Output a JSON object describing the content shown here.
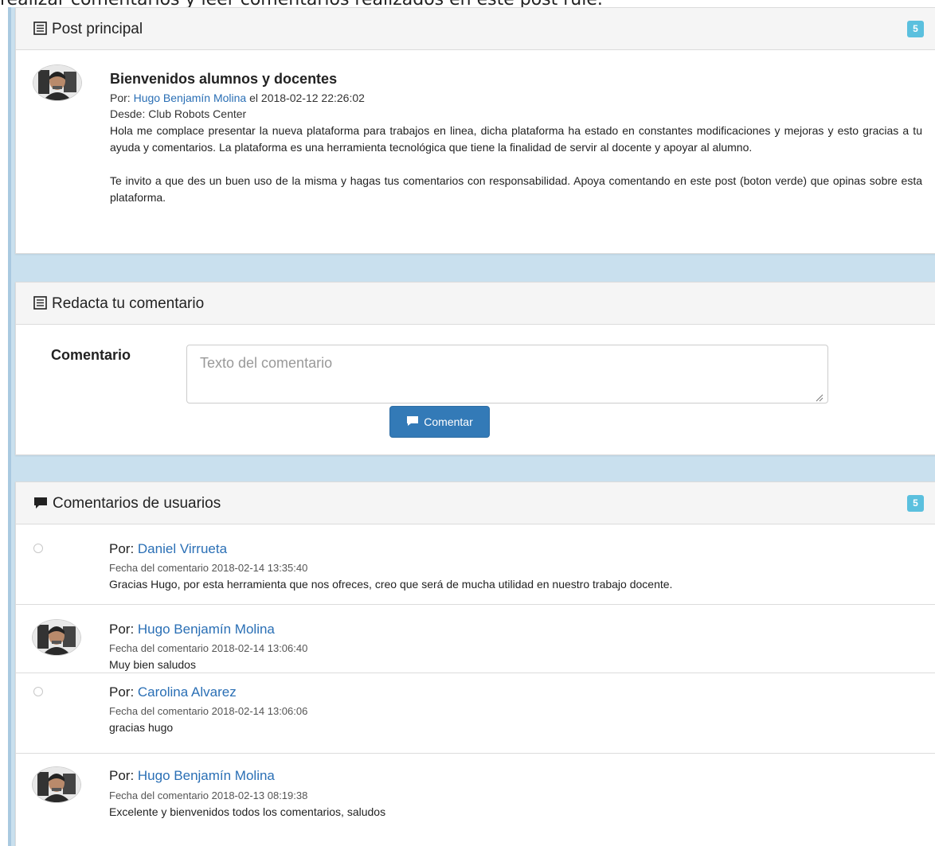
{
  "top_intro": "realizar comentarios y leer comentarios realizados en este post rule.",
  "post_panel": {
    "title": "Post principal",
    "icon": "list-alt-icon",
    "badge": "5",
    "post": {
      "title": "Bienvenidos alumnos y docentes",
      "by_prefix": "Por: ",
      "author": "Hugo Benjamín Molina",
      "date_prefix": " el ",
      "date": "2018-02-12 22:26:02",
      "from": "Desde: Club Robots Center",
      "paragraph1": "Hola me complace presentar la nueva plataforma para trabajos en linea, dicha plataforma ha estado en constantes modificaciones y mejoras y esto gracias a tu ayuda y comentarios. La plataforma es una herramienta tecnológica que tiene la finalidad de servir al docente y apoyar al alumno.",
      "paragraph2": "Te invito a que des un buen uso de la misma y hagas tus comentarios con responsabilidad. Apoya comentando en este post (boton verde) que opinas sobre esta plataforma."
    }
  },
  "comment_form": {
    "title": "Redacta tu comentario",
    "icon": "list-alt-icon",
    "label": "Comentario",
    "placeholder": "Texto del comentario",
    "value": "",
    "button_label": "Comentar",
    "button_icon": "comment-icon"
  },
  "comments_panel": {
    "title": "Comentarios de usuarios",
    "icon": "comment-icon",
    "badge": "5",
    "comments": [
      {
        "by_label": "Por: ",
        "author": "Daniel Virrueta",
        "date_label": "Fecha del comentario 2018-02-14 13:35:40",
        "text": "Gracias Hugo, por esta herramienta que nos ofreces, creo que será de mucha utilidad en nuestro trabajo docente.",
        "avatar": "empty"
      },
      {
        "by_label": "Por: ",
        "author": "Hugo Benjamín Molina",
        "date_label": "Fecha del comentario 2018-02-14 13:06:40",
        "text": "Muy bien saludos",
        "avatar": "photo"
      },
      {
        "by_label": "Por: ",
        "author": "Carolina Alvarez",
        "date_label": "Fecha del comentario 2018-02-14 13:06:06",
        "text": "gracias hugo",
        "avatar": "empty"
      },
      {
        "by_label": "Por: ",
        "author": "Hugo Benjamín Molina",
        "date_label": "Fecha del comentario 2018-02-13 08:19:38",
        "text": "Excelente y bienvenidos todos los comentarios, saludos",
        "avatar": "photo"
      }
    ]
  },
  "colors": {
    "link": "#2a6fb5",
    "badge": "#5bc0de",
    "primary_button": "#337ab7",
    "background": "#c9e0ee"
  }
}
